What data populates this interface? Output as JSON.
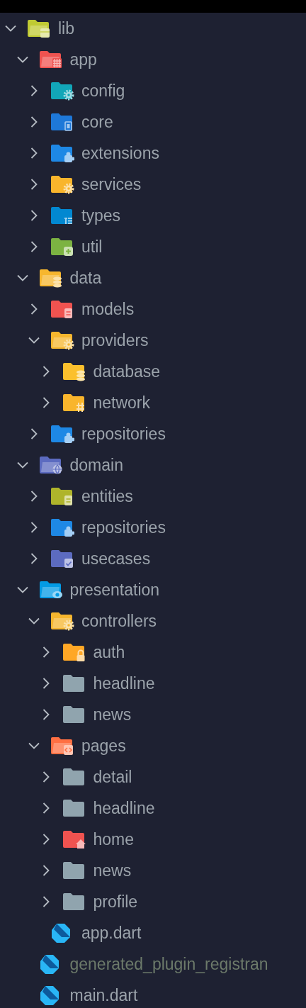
{
  "tree": [
    {
      "name": "lib",
      "kind": "folder",
      "expanded": true,
      "color": "#c0ca33",
      "dimmed": false,
      "children": [
        {
          "name": "app",
          "kind": "folder",
          "expanded": true,
          "color": "#ef5350",
          "dimmed": false,
          "children": [
            {
              "name": "config",
              "kind": "folder",
              "expanded": false,
              "color": "#12a6b8",
              "dimmed": false
            },
            {
              "name": "core",
              "kind": "folder",
              "expanded": false,
              "color": "#1e78d8",
              "dimmed": false
            },
            {
              "name": "extensions",
              "kind": "folder",
              "expanded": false,
              "color": "#1e88e5",
              "dimmed": false
            },
            {
              "name": "services",
              "kind": "folder",
              "expanded": false,
              "color": "#f9b52c",
              "dimmed": false
            },
            {
              "name": "types",
              "kind": "folder",
              "expanded": false,
              "color": "#0288d1",
              "dimmed": false
            },
            {
              "name": "util",
              "kind": "folder",
              "expanded": false,
              "color": "#7cb342",
              "dimmed": false
            }
          ]
        },
        {
          "name": "data",
          "kind": "folder",
          "expanded": true,
          "color": "#f6b62e",
          "dimmed": false,
          "children": [
            {
              "name": "models",
              "kind": "folder",
              "expanded": false,
              "color": "#ef5350",
              "dimmed": false
            },
            {
              "name": "providers",
              "kind": "folder",
              "expanded": true,
              "color": "#f6b62e",
              "dimmed": false,
              "children": [
                {
                  "name": "database",
                  "kind": "folder",
                  "expanded": false,
                  "color": "#fbc02d",
                  "dimmed": false
                },
                {
                  "name": "network",
                  "kind": "folder",
                  "expanded": false,
                  "color": "#f9b52c",
                  "dimmed": false
                }
              ]
            },
            {
              "name": "repositories",
              "kind": "folder",
              "expanded": false,
              "color": "#1e88e5",
              "dimmed": false
            }
          ]
        },
        {
          "name": "domain",
          "kind": "folder",
          "expanded": true,
          "color": "#5c6bc0",
          "dimmed": false,
          "children": [
            {
              "name": "entities",
              "kind": "folder",
              "expanded": false,
              "color": "#afb42b",
              "dimmed": false
            },
            {
              "name": "repositories",
              "kind": "folder",
              "expanded": false,
              "color": "#1e88e5",
              "dimmed": false
            },
            {
              "name": "usecases",
              "kind": "folder",
              "expanded": false,
              "color": "#5c6bc0",
              "dimmed": false
            }
          ]
        },
        {
          "name": "presentation",
          "kind": "folder",
          "expanded": true,
          "color": "#039be5",
          "dimmed": false,
          "children": [
            {
              "name": "controllers",
              "kind": "folder",
              "expanded": true,
              "color": "#f6b62e",
              "dimmed": false,
              "children": [
                {
                  "name": "auth",
                  "kind": "folder",
                  "expanded": false,
                  "color": "#ffa726",
                  "dimmed": false
                },
                {
                  "name": "headline",
                  "kind": "folder",
                  "expanded": false,
                  "color": "#90a4ae",
                  "dimmed": false
                },
                {
                  "name": "news",
                  "kind": "folder",
                  "expanded": false,
                  "color": "#90a4ae",
                  "dimmed": false
                }
              ]
            },
            {
              "name": "pages",
              "kind": "folder",
              "expanded": true,
              "color": "#ff7043",
              "dimmed": false,
              "children": [
                {
                  "name": "detail",
                  "kind": "folder",
                  "expanded": false,
                  "color": "#90a4ae",
                  "dimmed": false
                },
                {
                  "name": "headline",
                  "kind": "folder",
                  "expanded": false,
                  "color": "#90a4ae",
                  "dimmed": false
                },
                {
                  "name": "home",
                  "kind": "folder",
                  "expanded": false,
                  "color": "#ef5350",
                  "dimmed": false
                },
                {
                  "name": "news",
                  "kind": "folder",
                  "expanded": false,
                  "color": "#90a4ae",
                  "dimmed": false
                },
                {
                  "name": "profile",
                  "kind": "folder",
                  "expanded": false,
                  "color": "#90a4ae",
                  "dimmed": false
                }
              ]
            },
            {
              "name": "app.dart",
              "kind": "file",
              "dimmed": false
            }
          ]
        },
        {
          "name": "generated_plugin_registran",
          "kind": "file",
          "dimmed": true
        },
        {
          "name": "main.dart",
          "kind": "file",
          "dimmed": false
        }
      ]
    }
  ]
}
